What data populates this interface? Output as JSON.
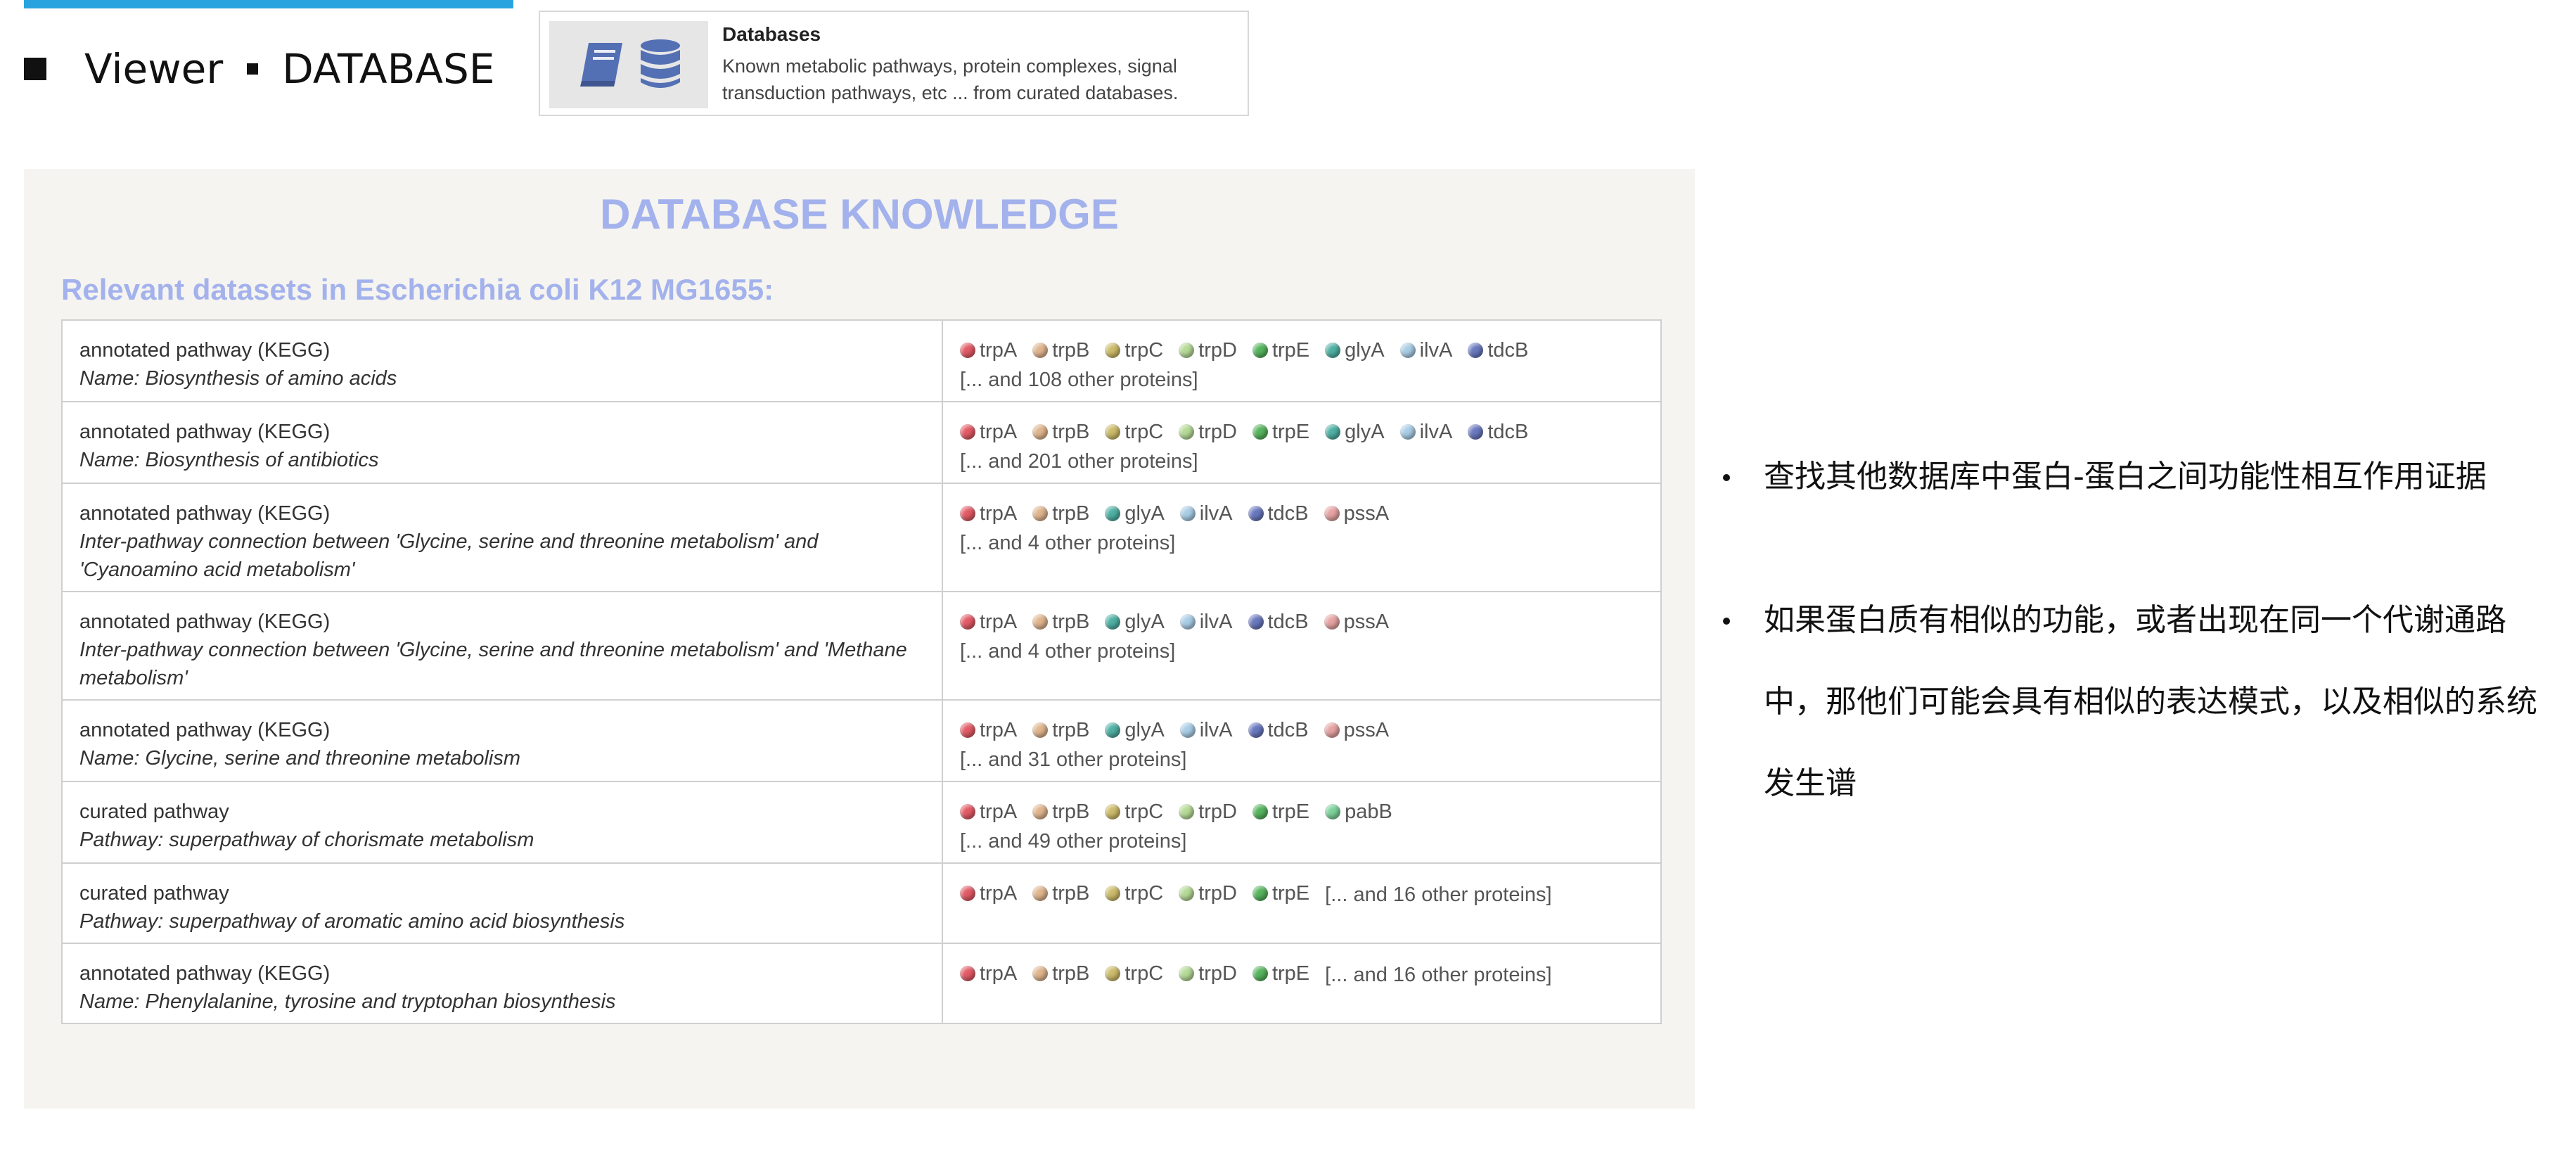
{
  "header": {
    "viewer_label": "Viewer",
    "section_label": "DATABASE"
  },
  "db_card": {
    "title": "Databases",
    "description": "Known metabolic pathways, protein complexes, signal transduction pathways, etc ... from curated databases.",
    "icons": [
      "book-icon",
      "database-icon"
    ]
  },
  "panel": {
    "title": "DATABASE KNOWLEDGE",
    "subtitle": "Relevant datasets in Escherichia coli K12 MG1655:"
  },
  "protein_colors": {
    "trpA": "#e35b66",
    "trpB": "#e0b58e",
    "trpC": "#cdbb6a",
    "trpD": "#b6db97",
    "trpE": "#56b45d",
    "glyA": "#4fb0a4",
    "ilvA": "#a9cde6",
    "tdcB": "#6a79bf",
    "pssA": "#e6a3a3",
    "pabB": "#7dd29a"
  },
  "rows": [
    {
      "source": "annotated pathway (KEGG)",
      "name": "Name: Biosynthesis of amino acids",
      "proteins": [
        "trpA",
        "trpB",
        "trpC",
        "trpD",
        "trpE",
        "glyA",
        "ilvA",
        "tdcB"
      ],
      "more": "[... and 108 other proteins]"
    },
    {
      "source": "annotated pathway (KEGG)",
      "name": "Name: Biosynthesis of antibiotics",
      "proteins": [
        "trpA",
        "trpB",
        "trpC",
        "trpD",
        "trpE",
        "glyA",
        "ilvA",
        "tdcB"
      ],
      "more": "[... and 201 other proteins]"
    },
    {
      "source": "annotated pathway (KEGG)",
      "name": "Inter-pathway connection between 'Glycine, serine and threonine metabolism' and 'Cyanoamino acid metabolism'",
      "proteins": [
        "trpA",
        "trpB",
        "glyA",
        "ilvA",
        "tdcB",
        "pssA"
      ],
      "more": "[... and 4 other proteins]"
    },
    {
      "source": "annotated pathway (KEGG)",
      "name": "Inter-pathway connection between 'Glycine, serine and threonine metabolism' and 'Methane metabolism'",
      "proteins": [
        "trpA",
        "trpB",
        "glyA",
        "ilvA",
        "tdcB",
        "pssA"
      ],
      "more": "[... and 4 other proteins]"
    },
    {
      "source": "annotated pathway (KEGG)",
      "name": "Name: Glycine, serine and threonine metabolism",
      "proteins": [
        "trpA",
        "trpB",
        "glyA",
        "ilvA",
        "tdcB",
        "pssA"
      ],
      "more": "[... and 31 other proteins]"
    },
    {
      "source": "curated pathway",
      "name": "Pathway: superpathway of chorismate metabolism",
      "proteins": [
        "trpA",
        "trpB",
        "trpC",
        "trpD",
        "trpE",
        "pabB"
      ],
      "more": "[... and 49 other proteins]"
    },
    {
      "source": "curated pathway",
      "name": "Pathway: superpathway of aromatic amino acid biosynthesis",
      "proteins": [
        "trpA",
        "trpB",
        "trpC",
        "trpD",
        "trpE"
      ],
      "more": "[... and 16 other proteins]"
    },
    {
      "source": "annotated pathway (KEGG)",
      "name": "Name: Phenylalanine, tyrosine and tryptophan biosynthesis",
      "proteins": [
        "trpA",
        "trpB",
        "trpC",
        "trpD",
        "trpE"
      ],
      "more": "[... and 16 other proteins]"
    }
  ],
  "notes": [
    "查找其他数据库中蛋白-蛋白之间功能性相互作用证据",
    "如果蛋白质有相似的功能，或者出现在同一个代谢通路中，那他们可能会具有相似的表达模式，以及相似的系统发生谱"
  ]
}
